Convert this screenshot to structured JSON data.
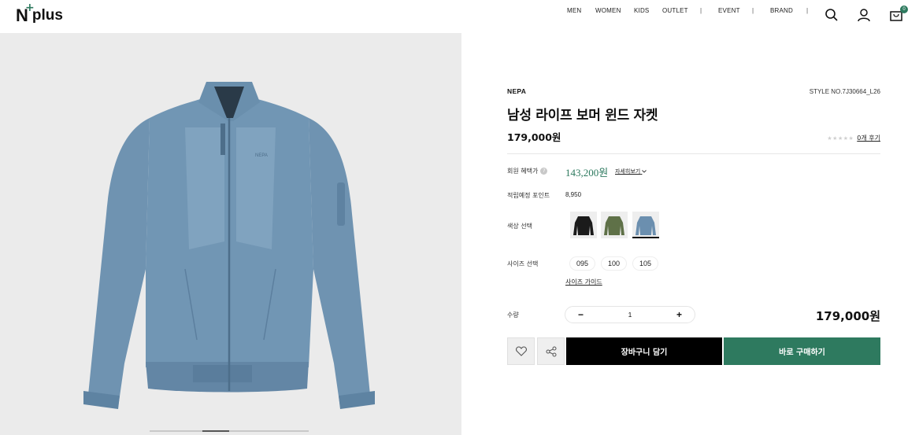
{
  "header": {
    "logo_text": "plus",
    "logo_letter": "N",
    "nav": [
      "MEN",
      "WOMEN",
      "KIDS",
      "OUTLET",
      "EVENT",
      "BRAND"
    ],
    "separator": "|",
    "cart_count": "0",
    "icons": [
      "search-icon",
      "user-icon",
      "cart-icon"
    ]
  },
  "product": {
    "brand": "NEPA",
    "style_no": "STYLE NO.7J30664_L26",
    "title": "남성 라이프 보머 윈드 자켓",
    "price": "179,000원",
    "stars": "★★★★★",
    "review_link": "0개 후기",
    "image_alt_color": "#6a8fad",
    "chest_logo": "NEPA"
  },
  "benefits": {
    "member_label": "회원 혜택가",
    "help": "?",
    "member_price": "143,200원",
    "detail_link": "자세히보기",
    "points_label": "적립예정 포인트",
    "points_value": "8,950"
  },
  "options": {
    "color_label": "색상 선택",
    "colors": [
      {
        "name": "black",
        "hex": "#1b1b1b"
      },
      {
        "name": "khaki",
        "hex": "#5f7148"
      },
      {
        "name": "blue",
        "hex": "#6b8faf",
        "selected": true
      }
    ],
    "size_label": "사이즈 선택",
    "sizes": [
      "095",
      "100",
      "105"
    ],
    "size_guide": "사이즈 가이드"
  },
  "quantity": {
    "label": "수량",
    "minus": "−",
    "value": "1",
    "plus": "+",
    "total": "179,000원"
  },
  "actions": {
    "cart": "장바구니 담기",
    "buy": "바로 구매하기"
  },
  "gallery": {
    "slide": 2,
    "slides": 6
  },
  "colors": {
    "accent": "#2e7a5f",
    "gallery_bg": "#ebebeb"
  }
}
